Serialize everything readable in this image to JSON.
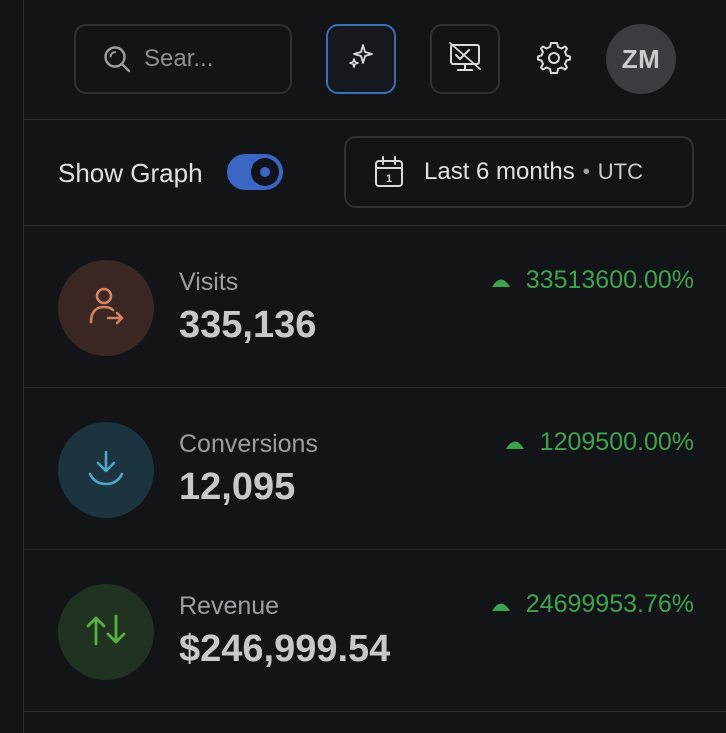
{
  "search": {
    "placeholder": "Sear..."
  },
  "header": {
    "avatar_initials": "ZM"
  },
  "controls": {
    "show_graph_label": "Show Graph",
    "show_graph_on": true,
    "range_label": "Last 6 months",
    "range_separator": "•",
    "timezone": "UTC"
  },
  "metrics": [
    {
      "label": "Visits",
      "value": "335,136",
      "change": "33513600.00%",
      "icon": "user-arrow-icon",
      "color": "#d3835f",
      "bg": "#3a2723"
    },
    {
      "label": "Conversions",
      "value": "12,095",
      "change": "1209500.00%",
      "icon": "download-icon",
      "color": "#4fa6c6",
      "bg": "#1c3340"
    },
    {
      "label": "Revenue",
      "value": "$246,999.54",
      "change": "24699953.76%",
      "icon": "swap-arrows-icon",
      "color": "#58b043",
      "bg": "#1f3320"
    }
  ],
  "colors": {
    "accent": "#3b66c4",
    "positive": "#3fa34d",
    "background": "#131417"
  }
}
